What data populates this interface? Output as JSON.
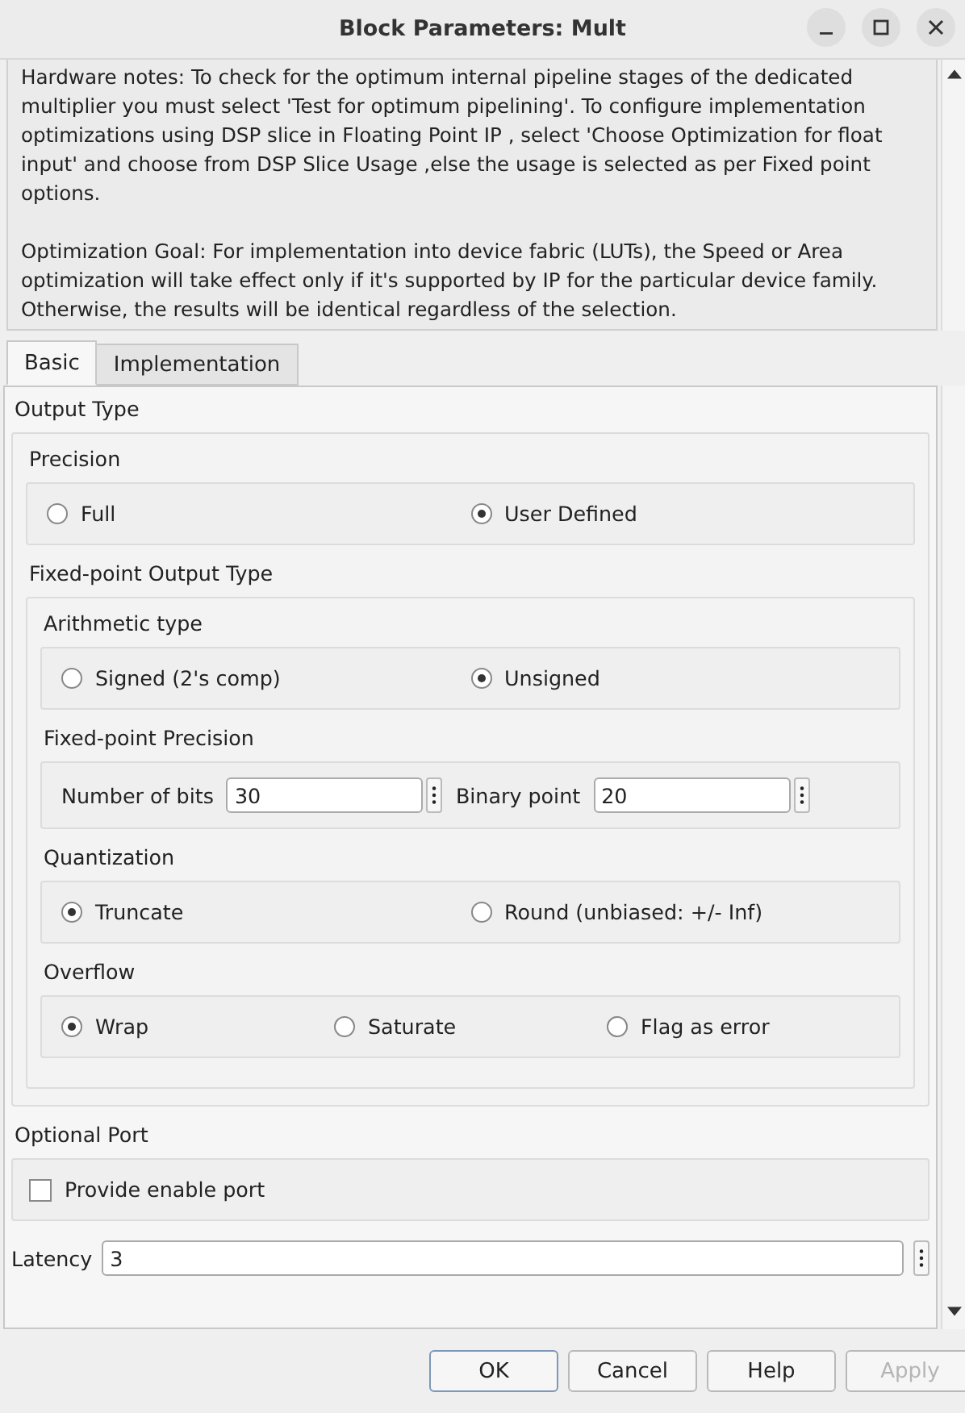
{
  "window": {
    "title": "Block Parameters: Mult"
  },
  "notes": [
    "Hardware notes: To check for the optimum internal pipeline stages of the dedicated multiplier you must select 'Test for optimum pipelining'. To configure implementation optimizations using DSP slice in Floating Point IP ,  select 'Choose  Optimization for float input' and choose from DSP Slice Usage ,else the usage is selected as per Fixed point options.",
    "Optimization Goal: For implementation into device fabric (LUTs), the Speed or Area optimization will take effect only if it's supported by IP for the particular device family. Otherwise, the results will be identical regardless of the selection."
  ],
  "tabs": [
    {
      "label": "Basic",
      "selected": true
    },
    {
      "label": "Implementation",
      "selected": false
    }
  ],
  "output_type": {
    "title": "Output Type",
    "precision": {
      "title": "Precision",
      "options": [
        {
          "label": "Full",
          "selected": false
        },
        {
          "label": "User Defined",
          "selected": true
        }
      ]
    },
    "fixed_point": {
      "title": "Fixed-point Output Type",
      "arithmetic": {
        "title": "Arithmetic type",
        "options": [
          {
            "label": "Signed  (2's comp)",
            "selected": false
          },
          {
            "label": "Unsigned",
            "selected": true
          }
        ]
      },
      "precision": {
        "title": "Fixed-point Precision",
        "fields": [
          {
            "label": "Number of bits",
            "value": "30"
          },
          {
            "label": "Binary point",
            "value": "20"
          }
        ]
      },
      "quantization": {
        "title": "Quantization",
        "options": [
          {
            "label": "Truncate",
            "selected": true
          },
          {
            "label": "Round  (unbiased: +/- Inf)",
            "selected": false
          }
        ]
      },
      "overflow": {
        "title": "Overflow",
        "options": [
          {
            "label": "Wrap",
            "selected": true
          },
          {
            "label": "Saturate",
            "selected": false
          },
          {
            "label": "Flag as error",
            "selected": false
          }
        ]
      }
    }
  },
  "optional_port": {
    "title": "Optional Port",
    "checkbox": {
      "label": "Provide enable port",
      "checked": false
    }
  },
  "latency": {
    "label": "Latency",
    "value": "3"
  },
  "buttons": [
    {
      "label": "OK",
      "disabled": false,
      "default": true
    },
    {
      "label": "Cancel",
      "disabled": false,
      "default": false
    },
    {
      "label": "Help",
      "disabled": false,
      "default": false
    },
    {
      "label": "Apply",
      "disabled": true,
      "default": false
    }
  ]
}
